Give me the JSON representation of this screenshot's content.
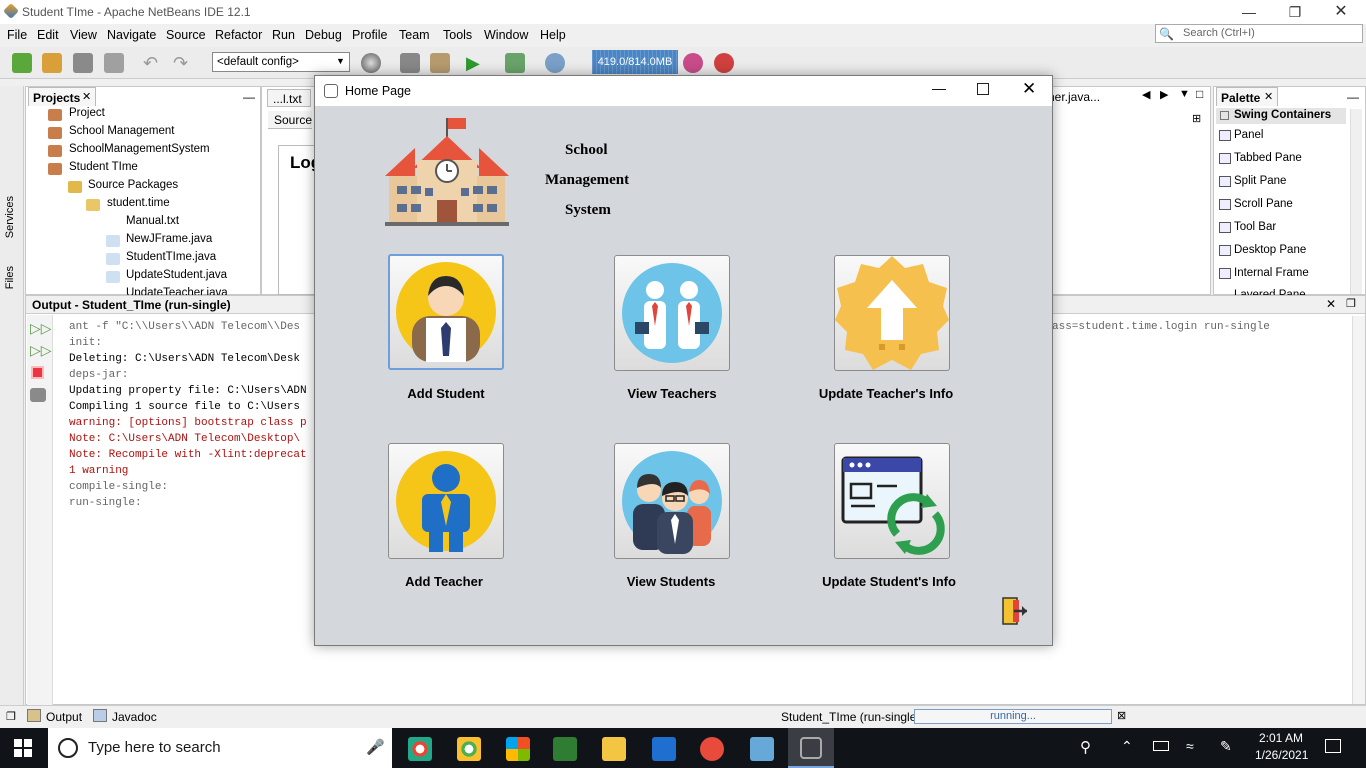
{
  "window": {
    "title": "Student TIme - Apache NetBeans IDE 12.1"
  },
  "menu": [
    "File",
    "Edit",
    "View",
    "Navigate",
    "Source",
    "Refactor",
    "Run",
    "Debug",
    "Profile",
    "Team",
    "Tools",
    "Window",
    "Help"
  ],
  "search": {
    "placeholder": "Search (Ctrl+I)"
  },
  "toolbar": {
    "config": "<default config>",
    "memory": "419.0/814.0MB"
  },
  "side_tabs": {
    "services": "Services",
    "files": "Files"
  },
  "projects": {
    "tab": "Projects",
    "items": [
      "Project",
      "School Management",
      "SchoolManagementSystem",
      "Student TIme",
      "Source Packages",
      "student.time",
      "Manual.txt",
      "NewJFrame.java",
      "StudentTIme.java",
      "UpdateStudent.java",
      "UpdateTeacher.java"
    ]
  },
  "editor": {
    "tab1": "...l.txt",
    "tab_right": "cher.java...",
    "source_tab": "Source",
    "login_text": "Log"
  },
  "palette": {
    "tab": "Palette",
    "section": "Swing Containers",
    "items": [
      "Panel",
      "Tabbed Pane",
      "Split Pane",
      "Scroll Pane",
      "Tool Bar",
      "Desktop Pane",
      "Internal Frame",
      "Layered Pane"
    ]
  },
  "output": {
    "title": "Output - Student_TIme (run-single)",
    "lines": [
      "ant -f \"C:\\\\Users\\\\ADN Telecom\\\\Des",
      "init:",
      "Deleting: C:\\Users\\ADN Telecom\\Desk",
      "deps-jar:",
      "Updating property file: C:\\Users\\ADN",
      "Compiling 1 source file to C:\\Users",
      "warning: [options] bootstrap class p",
      "Note: C:\\Users\\ADN Telecom\\Desktop\\",
      "Note: Recompile with -Xlint:deprecat",
      "1 warning",
      "compile-single:",
      "run-single:"
    ],
    "right_text": "ass=student.time.login run-single"
  },
  "status": {
    "tab_output": "Output",
    "tab_javadoc": "Javadoc",
    "run_label": "Student_TIme (run-single)",
    "progress": "running..."
  },
  "dialog": {
    "title": "Home Page",
    "school_line1": "School",
    "school_line2": "Management",
    "school_line3": "System",
    "tiles": [
      "Add Student",
      "View Teachers",
      "Update Teacher's Info",
      "Add Teacher",
      "View Students",
      "Update Student's Info"
    ]
  },
  "taskbar": {
    "search_placeholder": "Type here to search",
    "time": "2:01 AM",
    "date": "1/26/2021"
  },
  "colors": {
    "memory_bar": "#4a86c5",
    "dialog_bg": "#d4d7db",
    "taskbar": "#101419"
  }
}
